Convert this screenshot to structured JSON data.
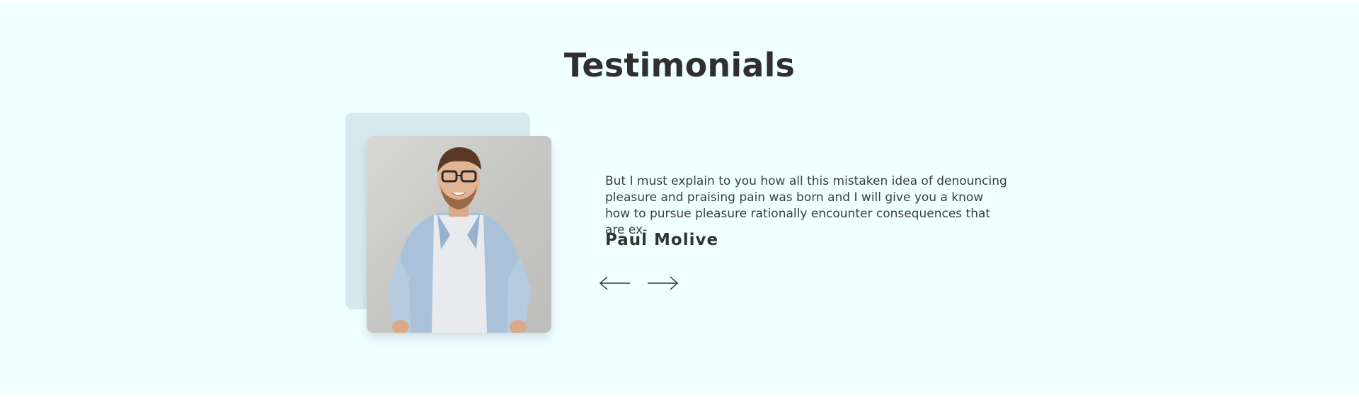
{
  "section": {
    "title": "Testimonials"
  },
  "testimonial": {
    "quote": "But I must explain to you how all this mistaken idea of denouncing pleasure and praising pain was born and I will give you a know how to pursue pleasure rationally encounter consequences that are ex-",
    "author": "Paul Molive",
    "photo_icon": "person-photo"
  },
  "navigation": {
    "prev_icon": "arrow-left-icon",
    "next_icon": "arrow-right-icon"
  },
  "colors": {
    "background": "#f0ffff",
    "backdrop": "#d6e9ef",
    "heading": "#2f2f2f",
    "text": "#3d3d3d"
  }
}
